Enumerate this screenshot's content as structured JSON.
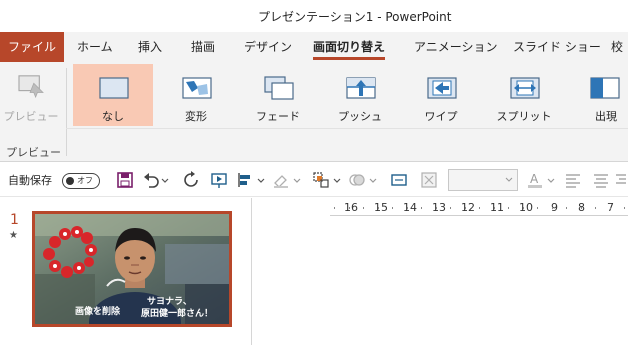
{
  "window": {
    "title": "プレゼンテーション1  -  PowerPoint"
  },
  "tabs": [
    {
      "label": "ファイル"
    },
    {
      "label": "ホーム"
    },
    {
      "label": "挿入"
    },
    {
      "label": "描画"
    },
    {
      "label": "デザイン"
    },
    {
      "label": "画面切り替え"
    },
    {
      "label": "アニメーション"
    },
    {
      "label": "スライド ショー"
    },
    {
      "label": "校"
    }
  ],
  "ribbon": {
    "preview": {
      "label": "プレビュー",
      "group_label": "プレビュー"
    },
    "transitions": [
      {
        "label": "なし",
        "icon": "none-transition-icon"
      },
      {
        "label": "変形",
        "icon": "morph-transition-icon"
      },
      {
        "label": "フェード",
        "icon": "fade-transition-icon"
      },
      {
        "label": "プッシュ",
        "icon": "push-transition-icon"
      },
      {
        "label": "ワイプ",
        "icon": "wipe-transition-icon"
      },
      {
        "label": "スプリット",
        "icon": "split-transition-icon"
      },
      {
        "label": "出現",
        "icon": "reveal-transition-icon"
      }
    ]
  },
  "qat": {
    "autosave_label": "自動保存",
    "toggle_text": "オフ"
  },
  "thumbnail": {
    "slide_number": "1",
    "star": "★",
    "caption_left": "画像を削除",
    "caption_right_line1": "サヨナラ、",
    "caption_right_line2": "原田健一郎さん！"
  },
  "ruler": {
    "ticks": [
      "16",
      "15",
      "14",
      "13",
      "12",
      "11",
      "10",
      "9",
      "8",
      "7"
    ]
  },
  "colors": {
    "accent": "#b7472a",
    "selected_bg": "#f9c9b4",
    "ribbon_bg": "#f3f3f3"
  }
}
